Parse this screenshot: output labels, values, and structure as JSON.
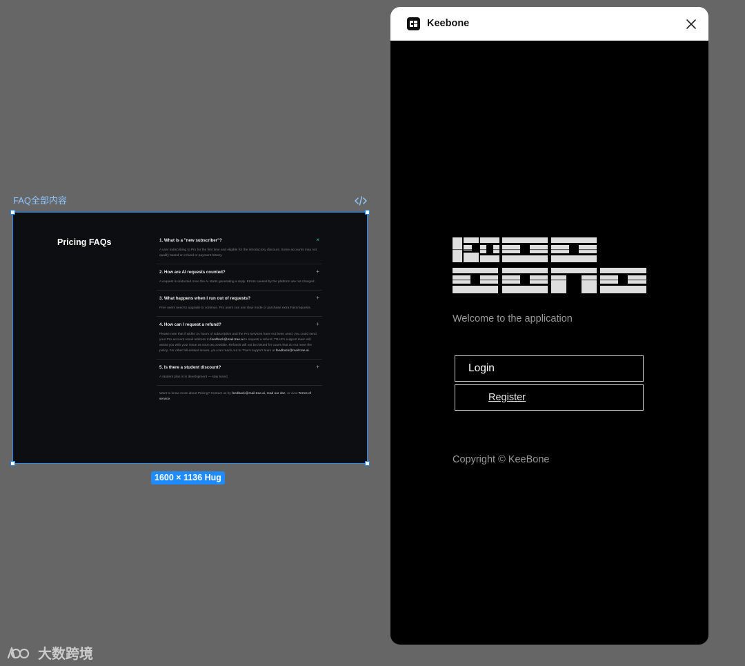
{
  "canvas": {
    "frame_label": "FAQ全部内容",
    "size_badge": "1600 × 1136 Hug"
  },
  "faq": {
    "heading": "Pricing FAQs",
    "items": [
      {
        "question": "1. What is a \"new subscriber\"?",
        "toggle": "×",
        "answer": "A user subscribing to Pro for the first time and eligible for the introductory discount. Some accounts may not qualify based on refund or payment history."
      },
      {
        "question": "2. How are AI requests counted?",
        "toggle": "+",
        "answer": "A request is deducted once the AI starts generating a reply. Errors caused by the platform are not charged."
      },
      {
        "question": "3. What happens when I run out of requests?",
        "toggle": "+",
        "answer": "Free users need to upgrade to continue. Pro users can use slow mode or purchase extra Fast requests."
      },
      {
        "question": "4. How can I request a refund?",
        "toggle": "+",
        "answer_parts": [
          "Please note that if within 24 hours of subscription and the Pro services have not been used, you could send your Pro account email address to ",
          "feedback@mail.trae.ai",
          " to request a refund. TRAE's support team will assist you with your issue as soon as possible. Refunds will not be issued for cases that do not meet the policy. For other bill-related issues, you can reach out to Trae's support team at ",
          "feedback@mail.trae.ai",
          "."
        ]
      },
      {
        "question": "5. Is there a student discount?",
        "toggle": "+",
        "answer": "A student plan is in development — stay tuned."
      }
    ],
    "footer": {
      "prefix": "Want to know more about Pricing? Contact us by ",
      "email": "feedback@mail.trae.ai",
      "mid": ", read our doc",
      "mid2": ", or view ",
      "terms": "Terms of service",
      "suffix": "."
    }
  },
  "app": {
    "title": "Keebone",
    "welcome": "Welcome to the application",
    "login_label": "Login",
    "register_label": "Register",
    "copyright": "Copyright © KeeBone"
  },
  "watermark": {
    "text": "大数跨境"
  },
  "colors": {
    "selection": "#1e8cff",
    "canvas_bg": "#666666",
    "faq_bg": "#0d0e11",
    "open_toggle": "#2fd6a0"
  },
  "icons": {
    "code": "code-brackets-icon",
    "close": "close-icon",
    "app": "keebone-app-icon"
  }
}
